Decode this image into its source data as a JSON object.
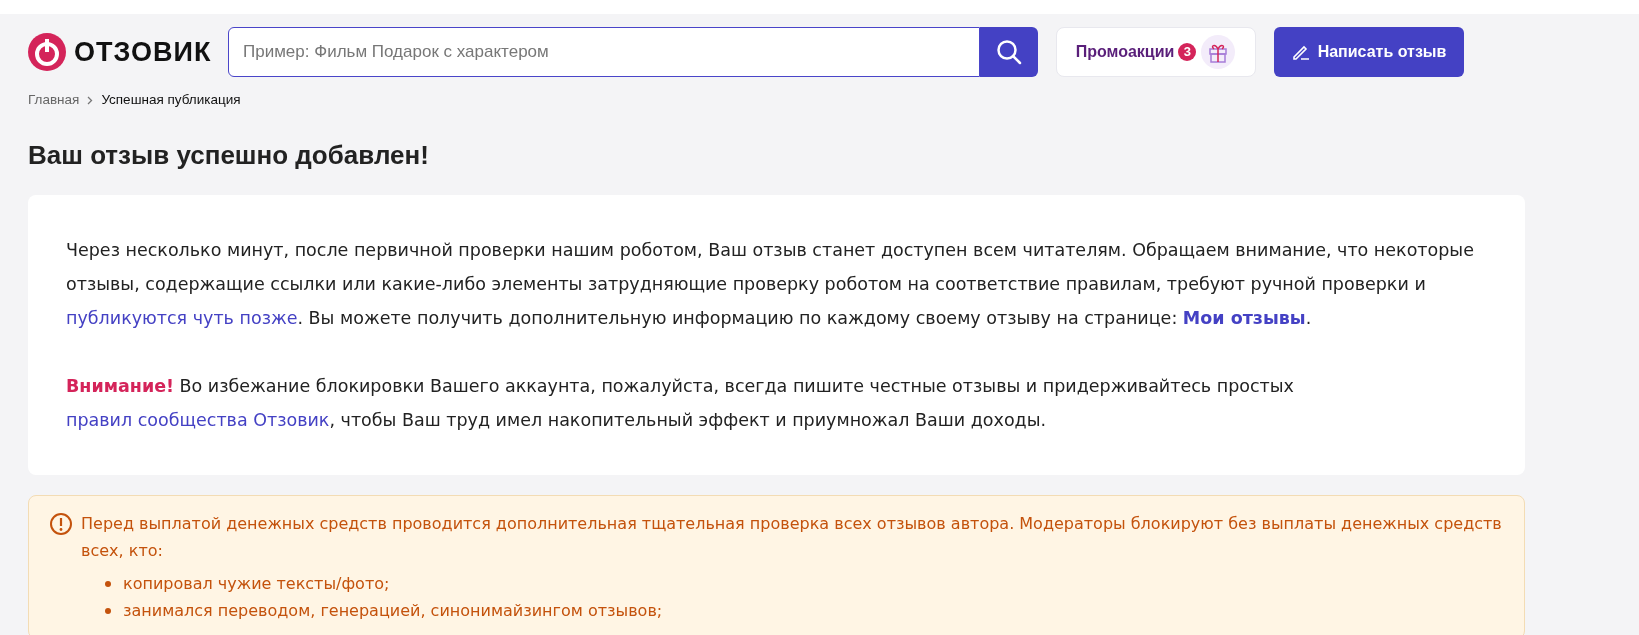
{
  "header": {
    "logo": "ОТЗОВИК",
    "search": {
      "placeholder": "Пример: Фильм Подарок с характером"
    },
    "promo": {
      "label": "Промоакции",
      "count": "3"
    },
    "write_button": "Написать отзыв"
  },
  "breadcrumbs": [
    {
      "label": "Главная",
      "current": false
    },
    {
      "label": "Успешная публикация",
      "current": true
    }
  ],
  "title": "Ваш отзыв успешно добавлен!",
  "card": {
    "paragraphs": [
      [
        {
          "kind": "text",
          "text": "Через несколько минут, после первичной проверки нашим роботом, Ваш отзыв станет доступен всем читателям. Обращаем внимание, что некоторые отзывы, содержащие ссылки или какие-либо элементы затрудняющие проверку роботом на соответствие правилам, требуют ручной проверки и "
        },
        {
          "kind": "link",
          "text": "публикуются чуть позже"
        },
        {
          "kind": "text",
          "text": ". Вы можете получить дополнительную информацию по каждому своему отзыву на странице: "
        },
        {
          "kind": "strong-link",
          "text": "Мои отзывы"
        },
        {
          "kind": "text",
          "text": "."
        }
      ],
      [
        {
          "kind": "alert",
          "text": "Внимание!"
        },
        {
          "kind": "text",
          "text": " Во избежание блокировки Вашего аккаунта, пожалуйста, всегда пишите честные отзывы и придерживайтесь простых "
        },
        {
          "kind": "link",
          "text": "правил сообщества Отзовик"
        },
        {
          "kind": "text",
          "text": ", чтобы Ваш труд имел накопительный эффект и приумножал Ваши доходы."
        }
      ]
    ]
  },
  "warning": {
    "text": "Перед выплатой денежных средств проводится дополнительная тщательная проверка всех отзывов автора. Модераторы блокируют без выплаты денежных средств всех, кто:",
    "items": [
      "копировал чужие тексты/фото;",
      "занимался переводом, генерацией, синонимайзингом отзывов;"
    ]
  }
}
